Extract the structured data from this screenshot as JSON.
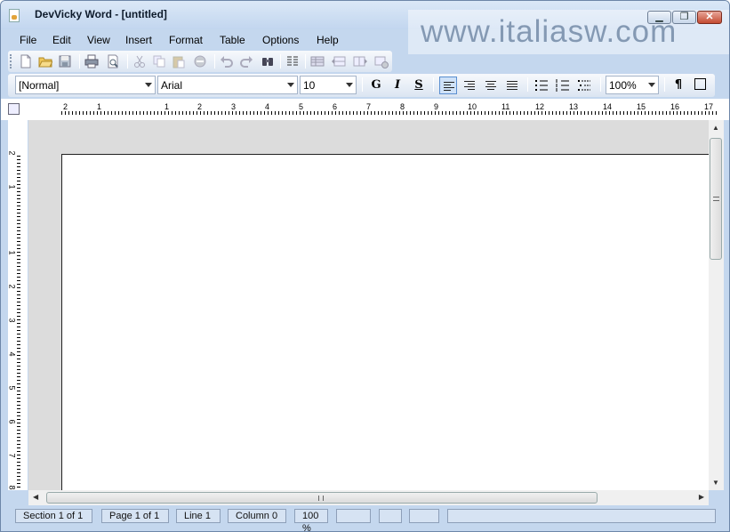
{
  "window": {
    "title": "DevVicky Word - [untitled]",
    "watermark": "www.italiasw.com"
  },
  "menu": [
    "File",
    "Edit",
    "View",
    "Insert",
    "Format",
    "Table",
    "Options",
    "Help"
  ],
  "format_toolbar": {
    "style": "[Normal]",
    "font": "Arial",
    "size": "10",
    "bold": "G",
    "italic": "I",
    "strike": "S",
    "zoom": "100%",
    "paragraph_mark": "¶"
  },
  "ruler": {
    "marks": [
      "2",
      "1",
      "1",
      "2",
      "3",
      "4",
      "5",
      "6",
      "7",
      "8",
      "9",
      "10",
      "11",
      "12",
      "13",
      "14",
      "15",
      "16",
      "17"
    ]
  },
  "vertical_ruler": {
    "marks": [
      "2",
      "1",
      "1",
      "2",
      "3",
      "4",
      "5",
      "6",
      "7",
      "8"
    ]
  },
  "status": {
    "section": "Section 1 of 1",
    "page": "Page 1 of 1",
    "line": "Line 1",
    "column": "Column 0",
    "zoom": "100 %"
  }
}
